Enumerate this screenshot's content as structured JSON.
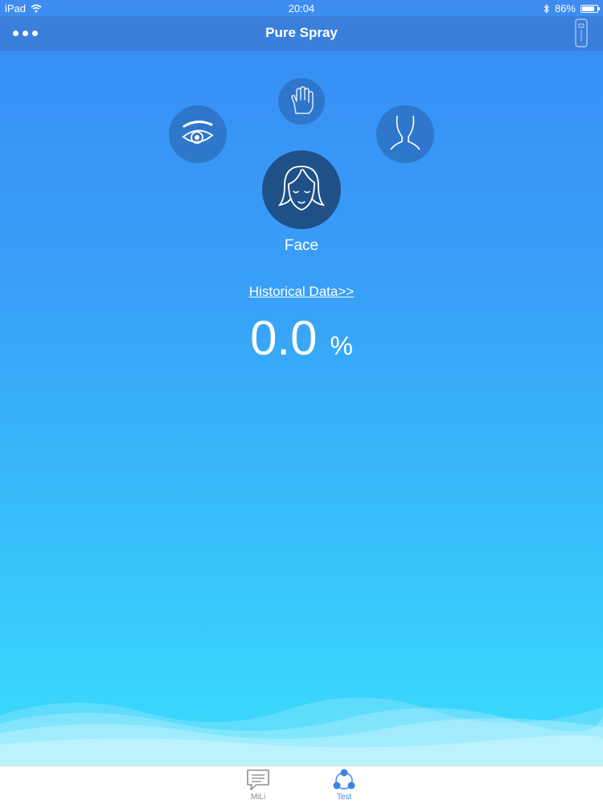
{
  "status_bar": {
    "device": "iPad",
    "time": "20:04",
    "battery_percent": "86%",
    "battery_level": 0.86
  },
  "nav_bar": {
    "title": "Pure Spray"
  },
  "body_parts": {
    "selected_label": "Face",
    "items": [
      "eye-icon",
      "hand-icon",
      "neck-icon",
      "face-icon"
    ]
  },
  "history_link": "Historical Data>>",
  "reading": {
    "value": "0.0",
    "unit": "%"
  },
  "tab_bar": {
    "tabs": [
      {
        "label": "MiLi",
        "icon": "chat-bubble-icon",
        "active": false
      },
      {
        "label": "Test",
        "icon": "connect-nodes-icon",
        "active": true
      }
    ],
    "active_color": "#3a86e8",
    "inactive_color": "#8e8e93"
  },
  "colors": {
    "nav_bar": "#3a7fdc",
    "selected_circle": "#1f5188",
    "gradient_top": "#3790f5",
    "gradient_bottom": "#3cdcfc"
  }
}
